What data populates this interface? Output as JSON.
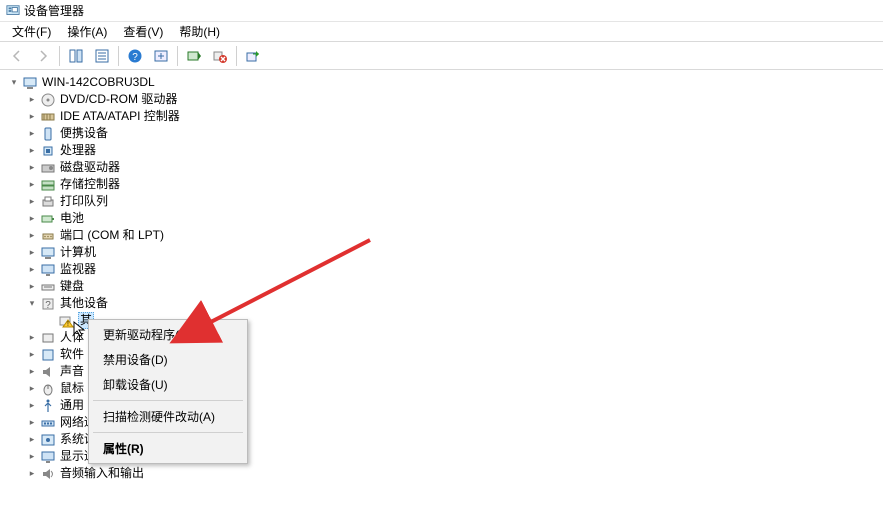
{
  "window": {
    "title": "设备管理器"
  },
  "menu": {
    "file": "文件(F)",
    "action": "操作(A)",
    "view": "查看(V)",
    "help": "帮助(H)"
  },
  "tree": {
    "root": "WIN-142COBRU3DL",
    "items": [
      "DVD/CD-ROM 驱动器",
      "IDE ATA/ATAPI 控制器",
      "便携设备",
      "处理器",
      "磁盘驱动器",
      "存储控制器",
      "打印队列",
      "电池",
      "端口 (COM 和 LPT)",
      "计算机",
      "监视器",
      "键盘",
      "其他设备",
      "人体",
      "软件",
      "声音",
      "鼠标",
      "通用",
      "网络适配器",
      "系统设备",
      "显示适配器",
      "音频输入和输出"
    ],
    "unknown_device": "其"
  },
  "context_menu": {
    "update": "更新驱动程序(P)",
    "disable": "禁用设备(D)",
    "uninstall": "卸载设备(U)",
    "scan": "扫描检测硬件改动(A)",
    "props": "属性(R)"
  }
}
